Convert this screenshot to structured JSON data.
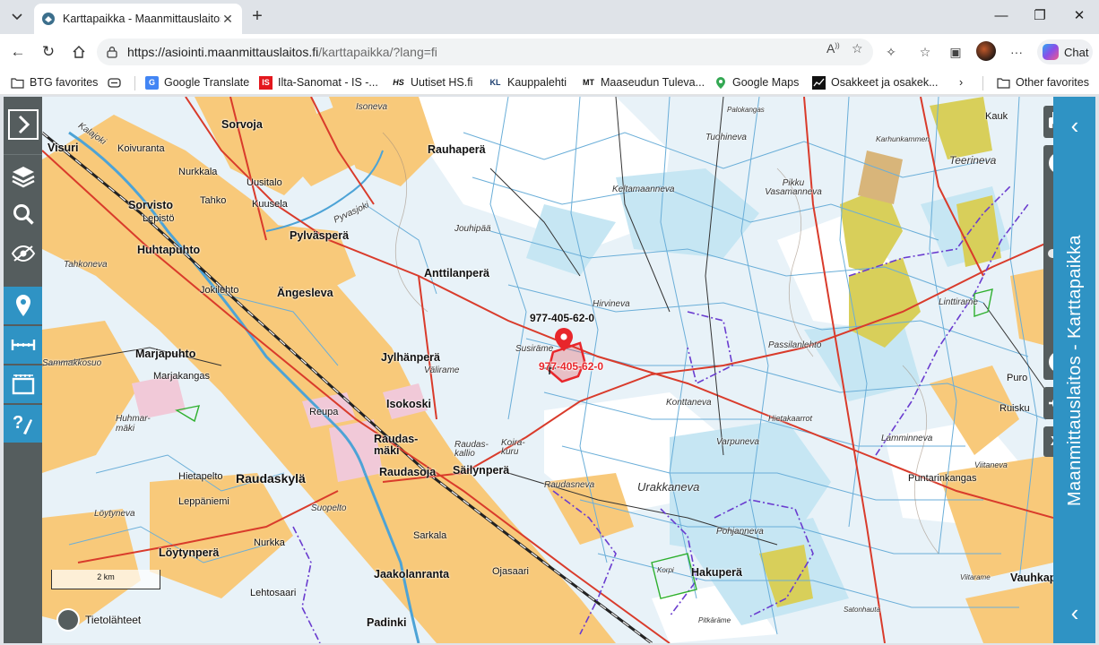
{
  "browser": {
    "tab_title": "Karttapaikka - Maanmittauslaitos",
    "url_host": "https://asiointi.maanmittauslaitos.fi",
    "url_path": "/karttapaikka/?lang=fi",
    "chat_label": "Chat"
  },
  "bookmarks": [
    {
      "label": "BTG favorites",
      "icon": "folder-icon"
    },
    {
      "label": "Google Translate",
      "icon": "translate-icon"
    },
    {
      "label": "Ilta-Sanomat - IS -...",
      "icon": "is-icon"
    },
    {
      "label": "Uutiset  HS.fi",
      "icon": "hs-icon"
    },
    {
      "label": "Kauppalehti",
      "icon": "kl-icon"
    },
    {
      "label": "Maaseudun Tuleva...",
      "icon": "mt-icon"
    },
    {
      "label": "Google Maps",
      "icon": "maps-icon"
    },
    {
      "label": "Osakkeet ja osakek...",
      "icon": "stocks-icon"
    },
    {
      "label": "Other favorites",
      "icon": "folder-icon"
    }
  ],
  "bookmark_icon_text": {
    "hs": "HS",
    "kl": "KL",
    "mt": "MT"
  },
  "map": {
    "side_panel_title": "Maanmittauslaitos - Karttapaikka",
    "scale_label": "2 km",
    "data_sources_label": "Tietolähteet",
    "xy_label": "XY",
    "parcel_ids": {
      "selected_black": "977-405-62-0",
      "selected_red": "977-405-62-0"
    },
    "place_labels": {
      "visuri": "Visuri",
      "koivuranta": "Koivuranta",
      "nurkkala": "Nurkkala",
      "kalajoki": "Kalajoki",
      "sorvoja": "Sorvoja",
      "isoneva": "Isoneva",
      "rauhapera": "Rauhaperä",
      "uusitalo": "Uusitalo",
      "tahko": "Tahko",
      "kuusela": "Kuusela",
      "sorvisto": "Sorvisto",
      "lepisto": "Lepistö",
      "pyvasjoki": "Pyvasjoki",
      "pylvaspera": "Pylväsperä",
      "jouhipaa": "Jouhipää",
      "huhtapuhto": "Huhtapuhto",
      "tahkoneva": "Tahkoneva",
      "jokilehto": "Jokilehto",
      "angesleva": "Ängesleva",
      "anttilanpera": "Anttilanperä",
      "hirvineva": "Hirvineva",
      "keltamaanneva": "Keltamaanneva",
      "palokangas": "Palokangas",
      "tuohineva": "Tuohineva",
      "karhunkammen": "Karhunkammen",
      "kauk": "Kauk",
      "teerineva": "Teerineva",
      "pikku_vasamanneva": "Pikku Vasamanneva",
      "linttirame": "Linttirame",
      "passilanlehto": "Passilanlehto",
      "sammakkosuo": "Sammakkosuo",
      "marjapuhto": "Marjapuhto",
      "marjakangas": "Marjakangas",
      "jylhanpera": "Jylhänperä",
      "susirame": "Susiräme",
      "valirame": "Välirame",
      "huhmarmaki": "Huhmar-mäki",
      "isokoski": "Isokoski",
      "reupa": "Reupa",
      "raudasmaki": "Raudas-mäki",
      "raudaskallio": "Raudas-kallio",
      "koirakuru": "Koira-kuru",
      "konttaneva": "Konttaneva",
      "hietakaarrot": "Hietakaarrot",
      "puro": "Puro",
      "ruisku": "Ruisku",
      "varpuneva": "Varpuneva",
      "lamminneva": "Lamminneva",
      "raudaskyla": "Raudaskylä",
      "raudasoja": "Raudasoja",
      "sailynpera": "Säilynperä",
      "hietapelto": "Hietapelto",
      "leppaniemi": "Leppäniemi",
      "viitaneva": "Viitaneva",
      "puntarinkangas": "Puntarinkangas",
      "raudasneva": "Raudasneva",
      "urakkaneva": "Urakkaneva",
      "loytyneva": "Löytyneva",
      "suopelto": "Suopelto",
      "sarkala": "Sarkala",
      "nurkka": "Nurkka",
      "pohjanneva": "Pohjanneva",
      "loytynpera": "Löytynperä",
      "korpi": "Korpi",
      "ojasaari": "Ojasaari",
      "jaakolanranta": "Jaakolanranta",
      "lehtosaari": "Lehtosaari",
      "hakupera": "Hakuperä",
      "viitarame": "Viitarame",
      "vauhkap": "Vauhkap",
      "padinki": "Padinki",
      "pitkarame": "Pitkäräme",
      "satonhauta": "Satonhauta"
    }
  },
  "colors": {
    "accent_blue": "#2f93c4",
    "rail_gray": "#555d5e",
    "parcel_red": "#e8262b",
    "field_orange": "#f7c87a",
    "forest_white": "#ffffff",
    "bog_blue": "#cfe8f5"
  }
}
